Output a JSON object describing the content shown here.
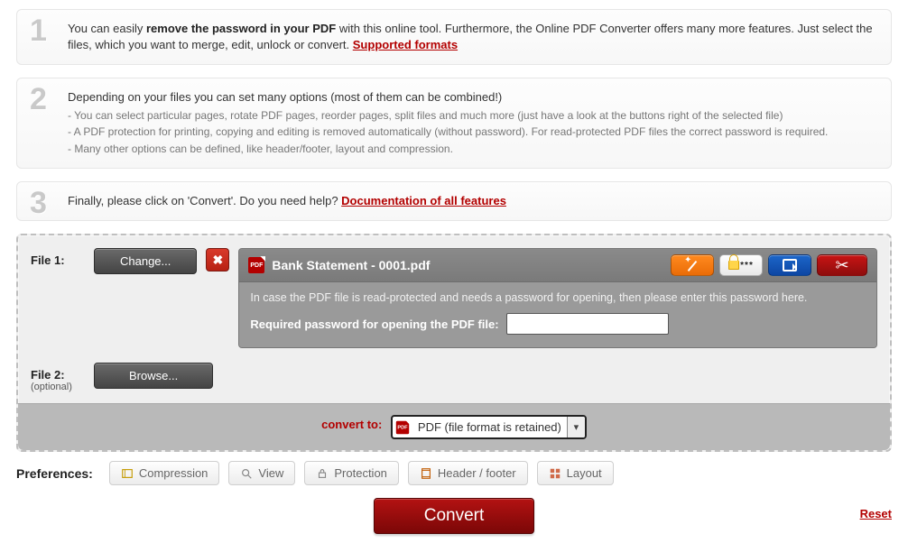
{
  "steps": {
    "s1": {
      "t1": "You can easily ",
      "bold": "remove the password in your PDF",
      "t2": " with this online tool. Furthermore, the Online PDF Converter offers many more features. Just select the files, which you want to merge, edit, unlock or convert. ",
      "link": "Supported formats"
    },
    "s2": {
      "head": "Depending on your files you can set many options (most of them can be combined!)",
      "b1": "- You can select particular pages, rotate PDF pages, reorder pages, split files and much more (just have a look at the buttons right of the selected file)",
      "b2": "- A PDF protection for printing, copying and editing is removed automatically (without password). For read-protected PDF files the correct password is required.",
      "b3": "- Many other options can be defined, like header/footer, layout and compression."
    },
    "s3": {
      "t1": "Finally, please click on 'Convert'. Do you need help? ",
      "link": "Documentation of all features"
    }
  },
  "file1": {
    "label": "File 1:",
    "change": "Change...",
    "filename": "Bank Statement - 0001.pdf",
    "hint": "In case the PDF file is read-protected and needs a password for opening, then please enter this password here.",
    "pwdlabel": "Required password for opening the PDF file:",
    "pwdvalue": ""
  },
  "file2": {
    "label": "File 2:",
    "optional": "(optional)",
    "browse": "Browse..."
  },
  "convert": {
    "label": "convert to:",
    "selected": "PDF (file format is retained)"
  },
  "prefs": {
    "label": "Preferences:",
    "compression": "Compression",
    "view": "View",
    "protection": "Protection",
    "header": "Header / footer",
    "layout": "Layout"
  },
  "actions": {
    "convert": "Convert",
    "reset": "Reset"
  }
}
